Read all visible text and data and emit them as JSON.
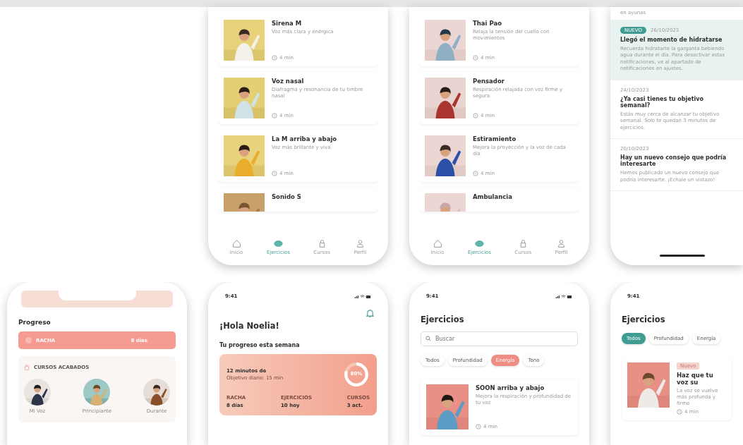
{
  "exercise_lists": [
    {
      "items": [
        {
          "title": "Sirena M",
          "description": "Voz más clara y enérgica",
          "duration": "4 min"
        },
        {
          "title": "Voz nasal",
          "description": "Diafragma y resonancia de tu timbre nasal",
          "duration": "4 min"
        },
        {
          "title": "La M arriba y abajo",
          "description": "Voz más brillante y viva",
          "duration": "4 min"
        },
        {
          "title": "Sonido S"
        }
      ],
      "tab_bar": [
        {
          "label": "Inicio",
          "selected": false
        },
        {
          "label": "Ejercicios",
          "selected": true
        },
        {
          "label": "Cursos",
          "selected": false
        },
        {
          "label": "Perfil",
          "selected": false
        }
      ]
    },
    {
      "items": [
        {
          "title": "Thai Pao",
          "description": "Relaja la tensión del cuello con movimientos",
          "duration": "4 min"
        },
        {
          "title": "Pensador",
          "description": "Respiración relajada con voz firme y segura",
          "duration": "4 min"
        },
        {
          "title": "Estiramiento",
          "description": "Mejora la proyección y la voz de cada día",
          "duration": "4 min"
        },
        {
          "title": "Ambulancia"
        }
      ],
      "tab_bar": [
        {
          "label": "Inicio",
          "selected": false
        },
        {
          "label": "Ejercicios",
          "selected": true
        },
        {
          "label": "Cursos",
          "selected": false
        },
        {
          "label": "Perfil",
          "selected": false
        }
      ]
    }
  ],
  "notifications": {
    "top_text": "en ayunas",
    "items": [
      {
        "badge": "NUEVO",
        "date": "26/10/2023",
        "title": "Llegó el momento de hidratarse",
        "body": "Recuerda hidratarte la garganta bebiendo agua durante el día. Para desactivar estas notificaciones, ve al apartado de notificaciones en ajustes.",
        "highlighted": true
      },
      {
        "date": "24/10/2023",
        "title": "¿Ya casi tienes tu objetivo semanal?",
        "body": "Estás muy cerca de alcanzar tu objetivo semanal. Solo te quedan 3 minutos de ejercicios.",
        "highlighted": false
      },
      {
        "date": "20/10/2023",
        "title": "Hay un nuevo consejo que podría interesarte",
        "body": "Hemos publicado un nuevo consejo que podría interesarte. ¡Echale un vistazo!",
        "highlighted": false
      }
    ]
  },
  "progress_screen": {
    "title": "Progreso",
    "streak": {
      "label": "RACHA",
      "value": "8 días"
    },
    "completed_courses": {
      "label": "CURSOS ACABADOS",
      "courses": [
        {
          "name": "Mi Voz"
        },
        {
          "name": "Principiante"
        },
        {
          "name": "Durante"
        }
      ]
    }
  },
  "home_screen": {
    "time": "9:41",
    "greeting": "¡Hola Noelia!",
    "subtitle": "Tu progreso esta semana",
    "card": {
      "title": "12 minutos de",
      "subtitle": "Objetivo diario: 15 min",
      "percent": "80%",
      "level": 0.8,
      "stats": [
        {
          "label": "RACHA",
          "value": "8 días"
        },
        {
          "label": "EJERCICIOS",
          "value": "10 hoy"
        },
        {
          "label": "CURSOS",
          "value": "3 act."
        }
      ]
    }
  },
  "search_screen": {
    "time": "9:41",
    "title": "Ejercicios",
    "search": {
      "placeholder": "Buscar"
    },
    "chips": [
      {
        "label": "Todos",
        "selected": false
      },
      {
        "label": "Profundidad",
        "selected": false
      },
      {
        "label": "Energía",
        "selected": true
      },
      {
        "label": "Tono",
        "selected": false
      }
    ],
    "item": {
      "title": "SOON arriba y abajo",
      "description": "Mejora la respiración y profundidad de tu voz",
      "duration": "4 min"
    }
  },
  "filter_screen": {
    "time": "9:41",
    "title": "Ejercicios",
    "chips": [
      {
        "label": "Todos",
        "selected": true
      },
      {
        "label": "Profundidad",
        "selected": false
      },
      {
        "label": "Energía",
        "selected": false
      }
    ],
    "item": {
      "tag": "Nuevo",
      "title": "Haz que tu voz su",
      "description": "La voz se vuelve más profunda y firme",
      "duration": "4 min"
    }
  }
}
